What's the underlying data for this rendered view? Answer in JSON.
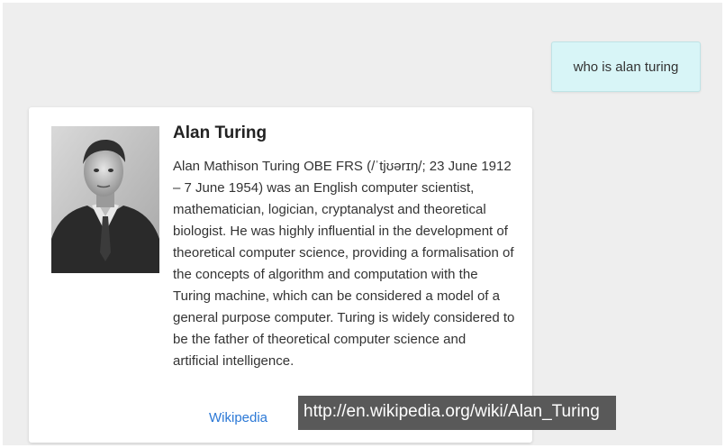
{
  "chat": {
    "user_message": "who is alan turing"
  },
  "card": {
    "title": "Alan Turing",
    "description": "Alan Mathison Turing OBE FRS (/ˈtjʊərɪŋ/; 23 June 1912 – 7 June 1954) was an English computer scientist, mathematician, logician, cryptanalyst and theoretical biologist. He was highly influential in the development of theoretical computer science, providing a formalisation of the concepts of algorithm and computation with the Turing machine, which can be considered a model of a general purpose computer. Turing is widely considered to be the father of theoretical computer science and artificial intelligence.",
    "link_label": "Wikipedia",
    "image_alt": "portrait-photo"
  },
  "tooltip": {
    "url": "http://en.wikipedia.org/wiki/Alan_Turing"
  },
  "colors": {
    "background": "#eeeeee",
    "user_bubble": "#d8f5f7",
    "link": "#2b78d6",
    "tooltip": "#595959"
  }
}
